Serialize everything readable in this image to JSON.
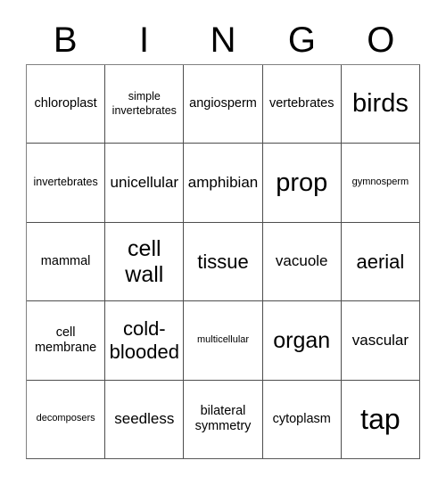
{
  "card": {
    "title": "BINGO",
    "header_letters": [
      "B",
      "I",
      "N",
      "G",
      "O"
    ],
    "columns": 5,
    "rows": 5,
    "border_color": "#4d4d4d",
    "background_color": "#ffffff",
    "text_color": "#000000",
    "rows_data": [
      [
        {
          "text": "chloroplast",
          "size": "md"
        },
        {
          "text": "simple invertebrates",
          "size": "sm"
        },
        {
          "text": "angiosperm",
          "size": "md"
        },
        {
          "text": "vertebrates",
          "size": "md"
        },
        {
          "text": "birds",
          "size": "3xl"
        }
      ],
      [
        {
          "text": "invertebrates",
          "size": "sm"
        },
        {
          "text": "unicellular",
          "size": "lg"
        },
        {
          "text": "amphibian",
          "size": "lg"
        },
        {
          "text": "prop",
          "size": "3xl"
        },
        {
          "text": "gymnosperm",
          "size": "xs"
        }
      ],
      [
        {
          "text": "mammal",
          "size": "md"
        },
        {
          "text": "cell wall",
          "size": "2xl"
        },
        {
          "text": "tissue",
          "size": "xl"
        },
        {
          "text": "vacuole",
          "size": "lg"
        },
        {
          "text": "aerial",
          "size": "xl"
        }
      ],
      [
        {
          "text": "cell membrane",
          "size": "md"
        },
        {
          "text": "cold-blooded",
          "size": "xl"
        },
        {
          "text": "multicellular",
          "size": "xs"
        },
        {
          "text": "organ",
          "size": "2xl"
        },
        {
          "text": "vascular",
          "size": "lg"
        }
      ],
      [
        {
          "text": "decomposers",
          "size": "xs"
        },
        {
          "text": "seedless",
          "size": "lg"
        },
        {
          "text": "bilateral symmetry",
          "size": "md"
        },
        {
          "text": "cytoplasm",
          "size": "md"
        },
        {
          "text": "tap",
          "size": "4xl"
        }
      ]
    ]
  }
}
